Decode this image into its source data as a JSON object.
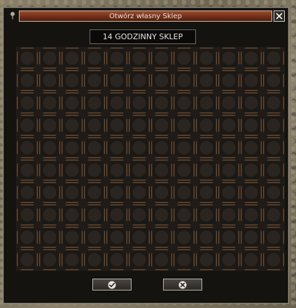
{
  "window": {
    "title": "Otwórz własny Sklep",
    "shop_name": "14 GODZINNY SKLEP"
  },
  "grid": {
    "columns": 12,
    "rows": 10
  },
  "buttons": {
    "confirm_icon": "checkmark-icon",
    "cancel_icon": "x-icon",
    "close_icon": "close-icon"
  },
  "colors": {
    "title_bar": "#7a3219",
    "slot_border": "#6a4a30",
    "window_bg": "#151310"
  }
}
